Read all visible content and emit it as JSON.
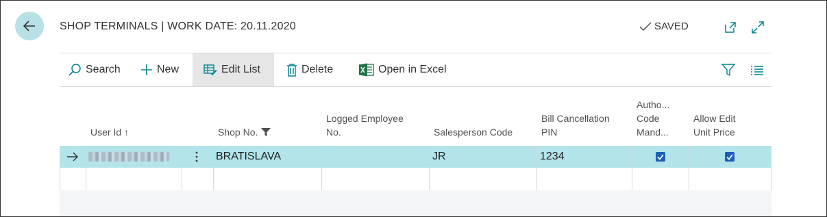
{
  "header": {
    "title": "SHOP TERMINALS | WORK DATE: 20.11.2020",
    "status": "SAVED"
  },
  "toolbar": {
    "search_label": "Search",
    "new_label": "New",
    "edit_list_label": "Edit List",
    "delete_label": "Delete",
    "open_excel_label": "Open in Excel"
  },
  "columns": {
    "user_id": "User Id",
    "user_id_sort": "↑",
    "shop_no": "Shop No.",
    "logged_employee_1": "Logged Employee",
    "logged_employee_2": "No.",
    "salesperson_code": "Salesperson Code",
    "bill_cancel_1": "Bill Cancellation",
    "bill_cancel_2": "PIN",
    "auth_1": "Autho...",
    "auth_2": "Code",
    "auth_3": "Mand...",
    "allow_edit_1": "Allow Edit",
    "allow_edit_2": "Unit Price"
  },
  "rows": [
    {
      "shop_no": "BRATISLAVA",
      "logged_employee_no": "",
      "salesperson_code": "JR",
      "bill_cancellation_pin": "1234",
      "auth_code_mandatory": true,
      "allow_edit_unit_price": true
    }
  ],
  "colors": {
    "accent": "#b7e1e6",
    "selected_row": "#b2e4ea",
    "checkbox": "#1c5fb8",
    "icon_teal": "#00838f",
    "excel_green": "#217346"
  },
  "icons": {
    "back": "arrow-left-icon",
    "saved": "checkmark-icon",
    "open_new_window": "open-new-window-icon",
    "expand": "expand-icon",
    "search": "search-icon",
    "new": "plus-icon",
    "edit_list": "edit-list-icon",
    "delete": "trash-icon",
    "excel": "excel-icon",
    "filter": "filter-icon",
    "list_options": "list-options-icon",
    "row_arrow": "arrow-right-icon",
    "row_menu": "more-vertical-icon"
  }
}
